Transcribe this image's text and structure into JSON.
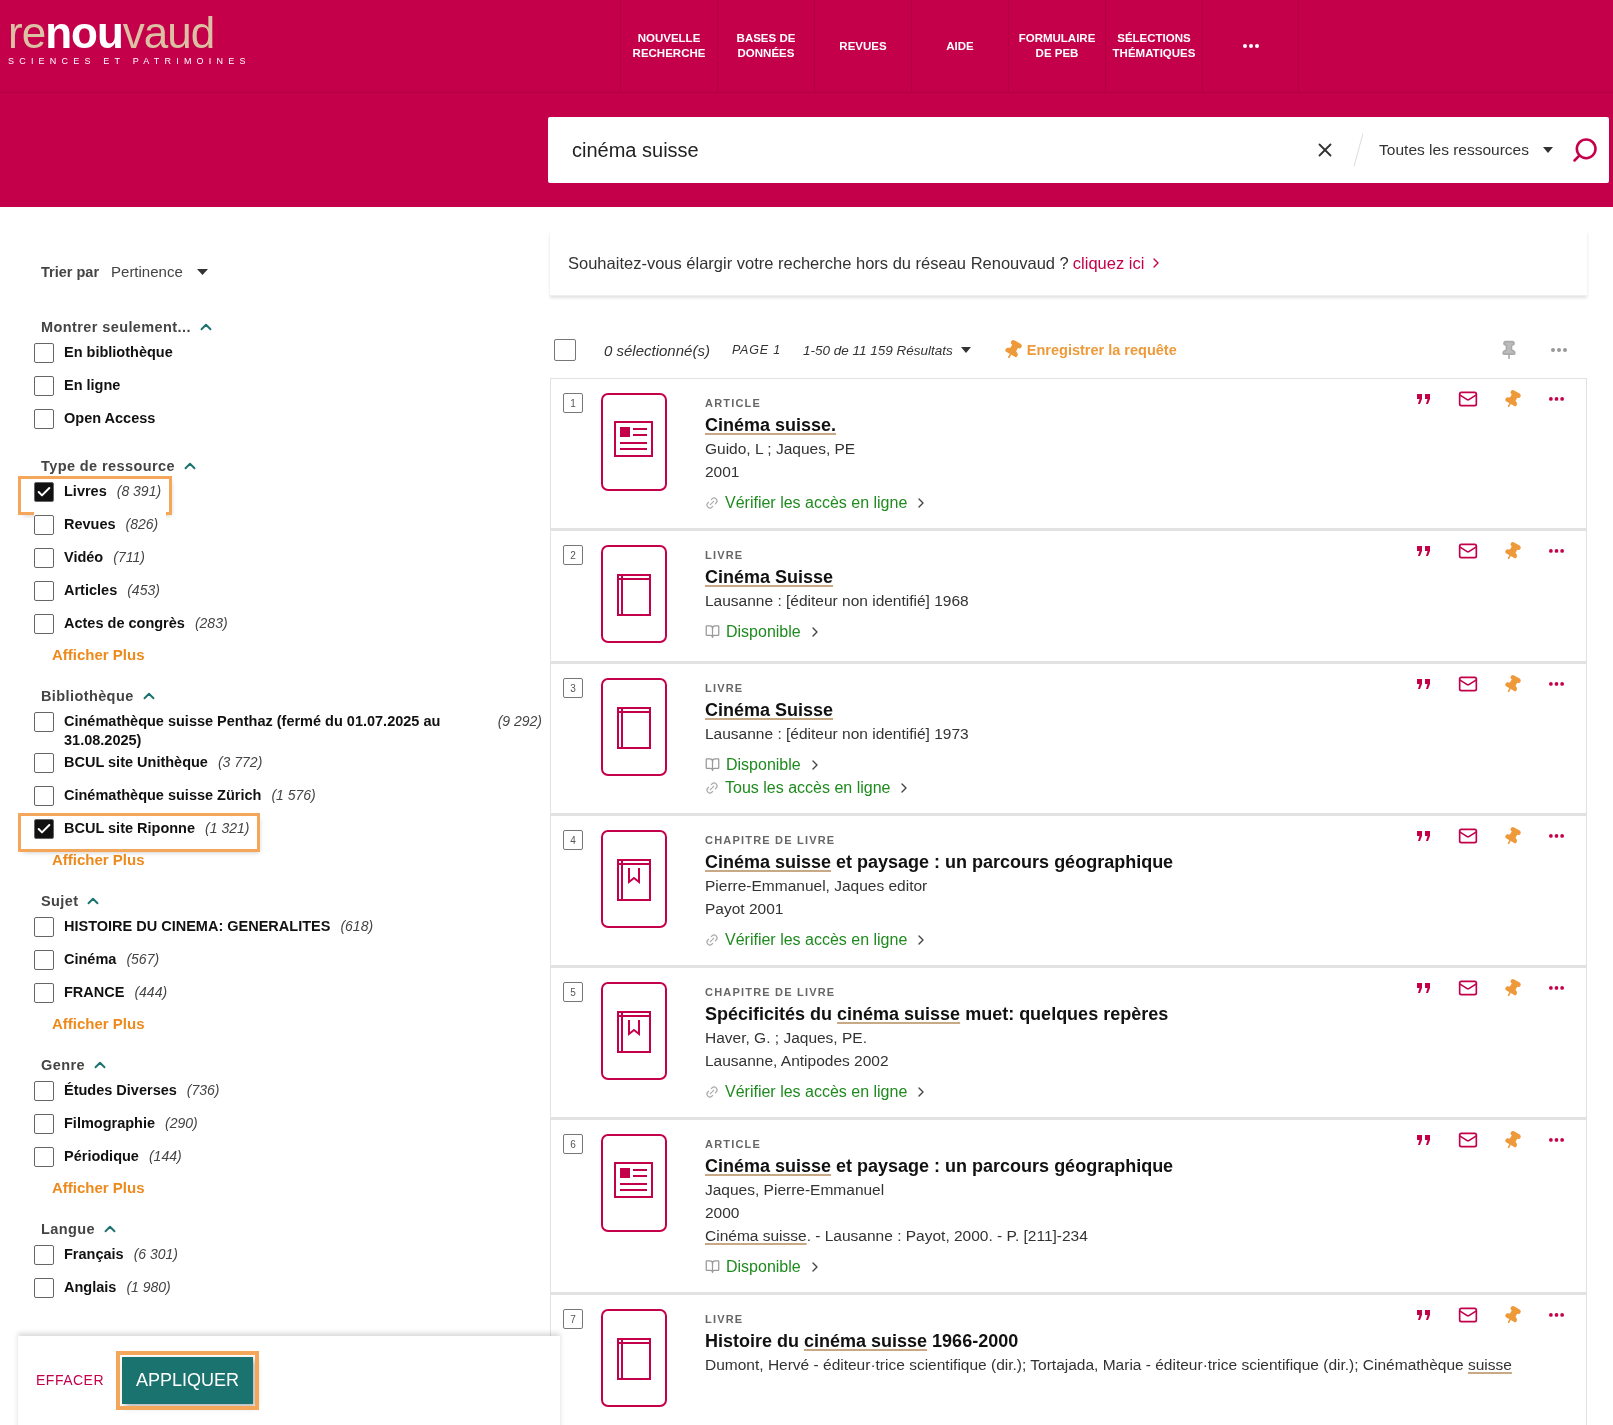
{
  "header": {
    "logo": {
      "parts": [
        {
          "text": "re",
          "emphasis": false
        },
        {
          "text": "nou",
          "emphasis": true
        },
        {
          "text": "vaud",
          "emphasis": false
        }
      ],
      "tagline": "SCIENCES ET PATRIMOINES"
    },
    "nav": [
      {
        "label": "NOUVELLE RECHERCHE"
      },
      {
        "label": "BASES DE DONNÉES"
      },
      {
        "label": "REVUES"
      },
      {
        "label": "AIDE"
      },
      {
        "label": "FORMULAIRE DE PEB"
      },
      {
        "label": "SÉLECTIONS THÉMATIQUES"
      }
    ]
  },
  "search": {
    "value": "cinéma suisse",
    "scope": "Toutes les ressources"
  },
  "sort": {
    "label": "Trier par",
    "value": "Pertinence"
  },
  "facets": [
    {
      "title": "Montrer seulement...",
      "expanded": true,
      "items": [
        {
          "label": "En bibliothèque",
          "checked": false,
          "highlighted": false
        },
        {
          "label": "En ligne",
          "checked": false,
          "highlighted": false
        },
        {
          "label": "Open Access",
          "checked": false,
          "highlighted": false
        }
      ]
    },
    {
      "title": "Type de ressource",
      "expanded": true,
      "show_more": "Afficher Plus",
      "items": [
        {
          "label": "Livres",
          "count": "(8 391)",
          "checked": true,
          "highlighted": true
        },
        {
          "label": "Revues",
          "count": "(826)",
          "checked": false,
          "highlighted": false
        },
        {
          "label": "Vidéo",
          "count": "(711)",
          "checked": false,
          "highlighted": false
        },
        {
          "label": "Articles",
          "count": "(453)",
          "checked": false,
          "highlighted": false
        },
        {
          "label": "Actes de congrès",
          "count": "(283)",
          "checked": false,
          "highlighted": false
        }
      ]
    },
    {
      "title": "Bibliothèque",
      "expanded": true,
      "show_more": "Afficher Plus",
      "items": [
        {
          "label": "Cinémathèque suisse Penthaz (fermé du 01.07.2025 au 31.08.2025)",
          "count": "(9 292)",
          "checked": false,
          "highlighted": false
        },
        {
          "label": "BCUL site Unithèque",
          "count": "(3 772)",
          "checked": false,
          "highlighted": false
        },
        {
          "label": "Cinémathèque suisse Zürich",
          "count": "(1 576)",
          "checked": false,
          "highlighted": false
        },
        {
          "label": "BCUL site Riponne",
          "count": "(1 321)",
          "checked": true,
          "highlighted": true
        }
      ]
    },
    {
      "title": "Sujet",
      "expanded": true,
      "show_more": "Afficher Plus",
      "items": [
        {
          "label": "HISTOIRE DU CINEMA: GENERALITES",
          "count": "(618)",
          "checked": false,
          "highlighted": false
        },
        {
          "label": "Cinéma",
          "count": "(567)",
          "checked": false,
          "highlighted": false
        },
        {
          "label": "FRANCE",
          "count": "(444)",
          "checked": false,
          "highlighted": false
        }
      ]
    },
    {
      "title": "Genre",
      "expanded": true,
      "show_more": "Afficher Plus",
      "items": [
        {
          "label": "Études Diverses",
          "count": "(736)",
          "checked": false,
          "highlighted": false
        },
        {
          "label": "Filmographie",
          "count": "(290)",
          "checked": false,
          "highlighted": false
        },
        {
          "label": "Périodique",
          "count": "(144)",
          "checked": false,
          "highlighted": false
        }
      ]
    },
    {
      "title": "Langue",
      "expanded": true,
      "items": [
        {
          "label": "Français",
          "count": "(6 301)",
          "checked": false,
          "highlighted": false
        },
        {
          "label": "Anglais",
          "count": "(1 980)",
          "checked": false,
          "highlighted": false
        }
      ]
    }
  ],
  "filter_actions": {
    "clear": "EFFACER",
    "apply": "APPLIQUER",
    "apply_highlighted": true
  },
  "expand_banner": {
    "text": "Souhaitez-vous élargir votre recherche hors du réseau Renouvaud ?",
    "link": "cliquez ici"
  },
  "toolbar": {
    "all_selected": false,
    "selection": "0 sélectionné(s)",
    "page": "PAGE 1",
    "range": "1-50 de 11 159 Résultats",
    "save_query": "Enregistrer la requête"
  },
  "results": [
    {
      "number": "1",
      "kind": "article",
      "type": "ARTICLE",
      "title": [
        {
          "text": "Cinéma suisse.",
          "highlight": true
        }
      ],
      "details": [
        [
          {
            "text": "Guido, L ; Jaques, PE",
            "highlight": false
          }
        ],
        [
          {
            "text": "2001",
            "highlight": false
          }
        ]
      ],
      "links": [
        {
          "kind": "online",
          "text": "Vérifier les accès en ligne"
        }
      ]
    },
    {
      "number": "2",
      "kind": "book",
      "type": "LIVRE",
      "title": [
        {
          "text": "Cinéma Suisse",
          "highlight": true
        }
      ],
      "details": [
        [
          {
            "text": "Lausanne : [éditeur non identifié] 1968",
            "highlight": false
          }
        ]
      ],
      "links": [
        {
          "kind": "available",
          "text": "Disponible"
        }
      ]
    },
    {
      "number": "3",
      "kind": "book",
      "type": "LIVRE",
      "title": [
        {
          "text": "Cinéma Suisse",
          "highlight": true
        }
      ],
      "details": [
        [
          {
            "text": "Lausanne : [éditeur non identifié] 1973",
            "highlight": false
          }
        ]
      ],
      "links": [
        {
          "kind": "available",
          "text": "Disponible"
        },
        {
          "kind": "online",
          "text": "Tous les accès en ligne"
        }
      ]
    },
    {
      "number": "4",
      "kind": "chapter",
      "type": "CHAPITRE DE LIVRE",
      "title": [
        {
          "text": "Cinéma suisse",
          "highlight": true
        },
        {
          "text": " et paysage : un parcours géographique",
          "highlight": false
        }
      ],
      "details": [
        [
          {
            "text": "Pierre-Emmanuel, Jaques editor",
            "highlight": false
          }
        ],
        [
          {
            "text": "Payot 2001",
            "highlight": false
          }
        ]
      ],
      "links": [
        {
          "kind": "online",
          "text": "Vérifier les accès en ligne"
        }
      ]
    },
    {
      "number": "5",
      "kind": "chapter",
      "type": "CHAPITRE DE LIVRE",
      "title": [
        {
          "text": "Spécificités du ",
          "highlight": false
        },
        {
          "text": "cinéma suisse",
          "highlight": true
        },
        {
          "text": " muet: quelques repères",
          "highlight": false
        }
      ],
      "details": [
        [
          {
            "text": "Haver, G. ; Jaques, PE.",
            "highlight": false
          }
        ],
        [
          {
            "text": "Lausanne, Antipodes 2002",
            "highlight": false
          }
        ]
      ],
      "links": [
        {
          "kind": "online",
          "text": "Vérifier les accès en ligne"
        }
      ]
    },
    {
      "number": "6",
      "kind": "article",
      "type": "ARTICLE",
      "title": [
        {
          "text": "Cinéma suisse",
          "highlight": true
        },
        {
          "text": " et paysage : un parcours géographique",
          "highlight": false
        }
      ],
      "details": [
        [
          {
            "text": "Jaques, Pierre-Emmanuel",
            "highlight": false
          }
        ],
        [
          {
            "text": "2000",
            "highlight": false
          }
        ],
        [
          {
            "text": "Cinéma suisse",
            "highlight": true
          },
          {
            "text": ". - Lausanne : Payot, 2000. - P. [211]-234",
            "highlight": false
          }
        ]
      ],
      "links": [
        {
          "kind": "available",
          "text": "Disponible"
        }
      ]
    },
    {
      "number": "7",
      "kind": "book",
      "type": "LIVRE",
      "title": [
        {
          "text": "Histoire du ",
          "highlight": false
        },
        {
          "text": "cinéma suisse",
          "highlight": true
        },
        {
          "text": " 1966-2000",
          "highlight": false
        }
      ],
      "details": [
        [
          {
            "text": "Dumont, Hervé - éditeur·trice scientifique (dir.); Tortajada, Maria - éditeur·trice scientifique (dir.); Cinémathèque ",
            "highlight": false
          },
          {
            "text": "suisse",
            "highlight": true
          }
        ]
      ]
    }
  ]
}
